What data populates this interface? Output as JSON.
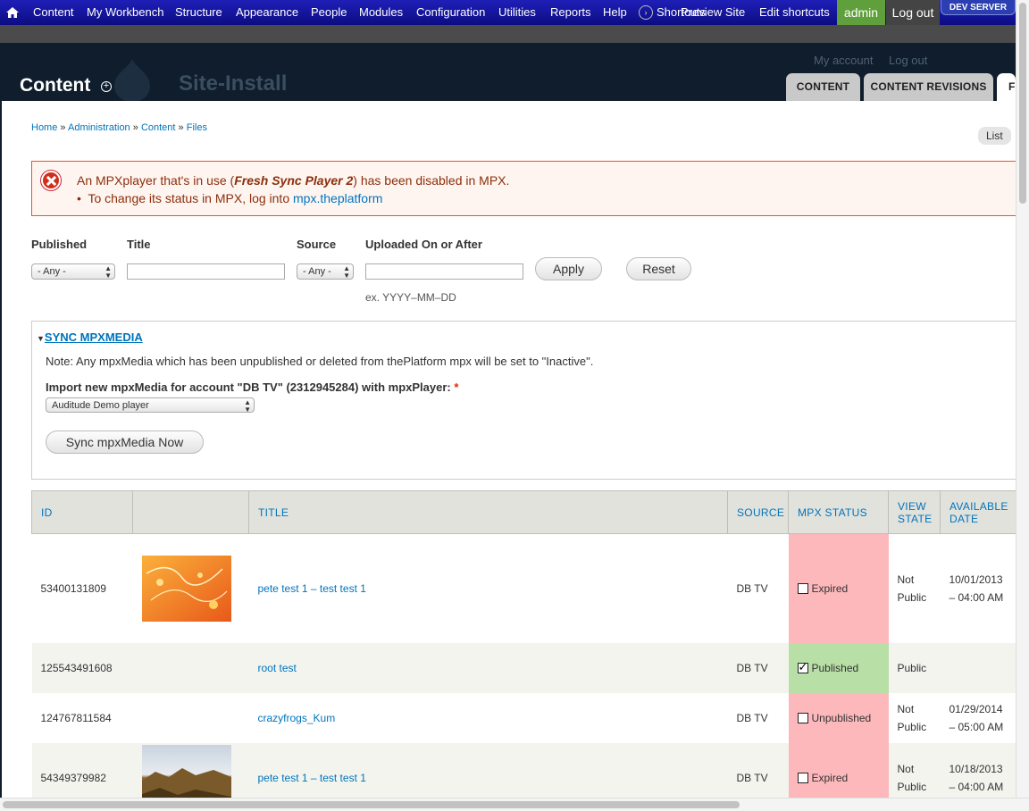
{
  "toolbar": {
    "items": [
      "Content",
      "My Workbench",
      "Structure",
      "Appearance",
      "People",
      "Modules",
      "Configuration",
      "Utilities",
      "Reports",
      "Help"
    ],
    "shortcuts": "Shortcuts",
    "preview_site": "Preview Site",
    "edit_shortcuts": "Edit shortcuts",
    "user": "admin",
    "logout": "Log out",
    "env_badge": "DEV SERVER"
  },
  "header": {
    "page_title": "Content",
    "site_name": "Site-Install",
    "my_account": "My account",
    "log_out": "Log out",
    "tabs": [
      "CONTENT",
      "CONTENT REVISIONS",
      "FI"
    ]
  },
  "breadcrumb": {
    "items": [
      "Home",
      "Administration",
      "Content",
      "Files"
    ],
    "sep": "»"
  },
  "secondary_tab": "List",
  "message": {
    "text_before": "An MPXplayer that's in use (",
    "player": "Fresh Sync Player 2",
    "text_after": ") has been disabled in MPX.",
    "bullet_text": "To change its status in MPX, log into ",
    "link": "mpx.theplatform"
  },
  "filters": {
    "published_label": "Published",
    "published_value": "- Any -",
    "title_label": "Title",
    "title_value": "",
    "source_label": "Source",
    "source_value": "- Any -",
    "uploaded_label": "Uploaded On or After",
    "uploaded_value": "",
    "date_hint": "ex. YYYY–MM–DD",
    "apply": "Apply",
    "reset": "Reset"
  },
  "sync": {
    "legend": "SYNC MPXMEDIA",
    "note": "Note: Any mpxMedia which has been unpublished or deleted from thePlatform mpx will be set to \"Inactive\".",
    "import_label": "Import new mpxMedia for account \"DB TV\" (2312945284) with mpxPlayer:",
    "required_mark": "*",
    "player_value": "Auditude Demo player",
    "button": "Sync mpxMedia Now"
  },
  "table": {
    "headers": {
      "id": "ID",
      "thumb": "",
      "title": "TITLE",
      "source": "SOURCE",
      "mpx_status": "MPX STATUS",
      "view_state_1": "VIEW",
      "view_state_2": "STATE",
      "available_1": "AVAILABLE",
      "available_2": "DATE"
    },
    "rows": [
      {
        "id": "53400131809",
        "title": "pete test 1 – test test 1",
        "source": "DB TV",
        "status": "Expired",
        "view_1": "Not",
        "view_2": "Public",
        "date_1": "10/01/2013",
        "date_2": "– 04:00 AM"
      },
      {
        "id": "125543491608",
        "title": "root test",
        "source": "DB TV",
        "status": "Published",
        "view_1": "Public",
        "view_2": "",
        "date_1": "",
        "date_2": ""
      },
      {
        "id": "124767811584",
        "title": "crazyfrogs_Kum",
        "source": "DB TV",
        "status": "Unpublished",
        "view_1": "Not",
        "view_2": "Public",
        "date_1": "01/29/2014",
        "date_2": "– 05:00 AM"
      },
      {
        "id": "54349379982",
        "title": "pete test 1 – test test 1",
        "source": "DB TV",
        "status": "Expired",
        "view_1": "Not",
        "view_2": "Public",
        "date_1": "10/18/2013",
        "date_2": "– 04:00 AM"
      }
    ]
  },
  "colors": {
    "toolbar": "#0c0c82",
    "header": "#0f1d2c",
    "link": "#0074bd",
    "status_bad": "#fcb8bb",
    "status_good": "#b8dfa5",
    "error_border": "#ed541d"
  }
}
